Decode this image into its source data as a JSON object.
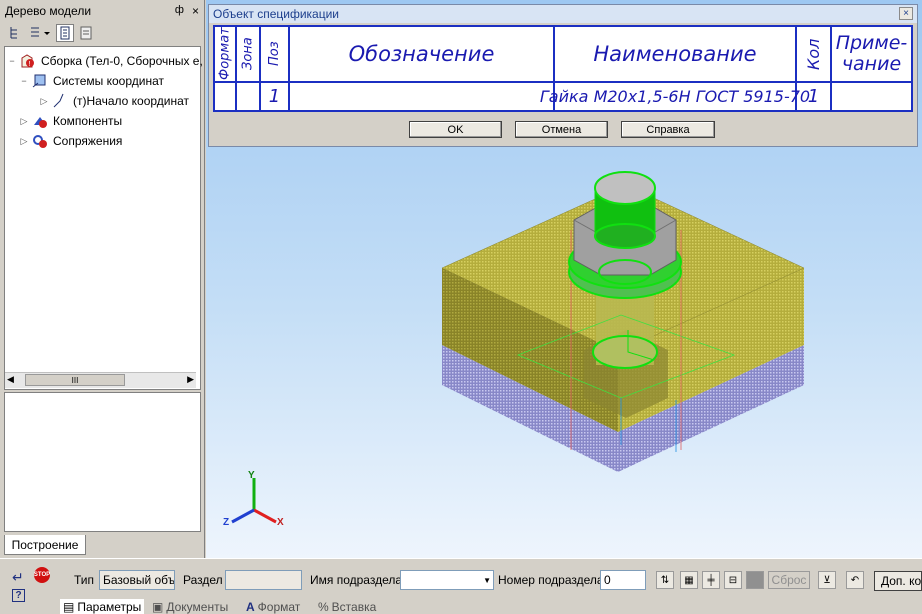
{
  "tree": {
    "title": "Дерево модели",
    "pin": "ф",
    "close": "×",
    "nodes": [
      "Сборка (Тел-0, Сборочных е,",
      "Системы координат",
      "(т)Начало координат",
      "Компоненты",
      "Сопряжения"
    ],
    "scroll_thumb": "III",
    "tab": "Построение"
  },
  "dialog": {
    "title": "Объект спецификации",
    "headers": {
      "format": "Формат",
      "zone": "Зона",
      "pos": "Поз",
      "designation": "Обозначение",
      "name": "Наименование",
      "qty": "Кол",
      "note": "Приме-\nчание"
    },
    "row": {
      "pos": "1",
      "name": "Гайка М20х1,5-6Н ГОСТ 5915-70",
      "qty": "1"
    },
    "ok": "OK",
    "cancel": "Отмена",
    "help": "Справка"
  },
  "axes": {
    "x": "X",
    "y": "Y",
    "z": "Z"
  },
  "props": {
    "stop": "STOP",
    "type_label": "Тип",
    "type_value": "Базовый объ",
    "section_label": "Раздел",
    "subsection_label": "Имя подраздела",
    "subsection_num_label": "Номер подраздела",
    "subsection_num_value": "0",
    "reset": "Сброс",
    "extra": "Доп. ко",
    "tabs": [
      "Параметры",
      "Документы",
      "Формат",
      "Вставка"
    ]
  }
}
